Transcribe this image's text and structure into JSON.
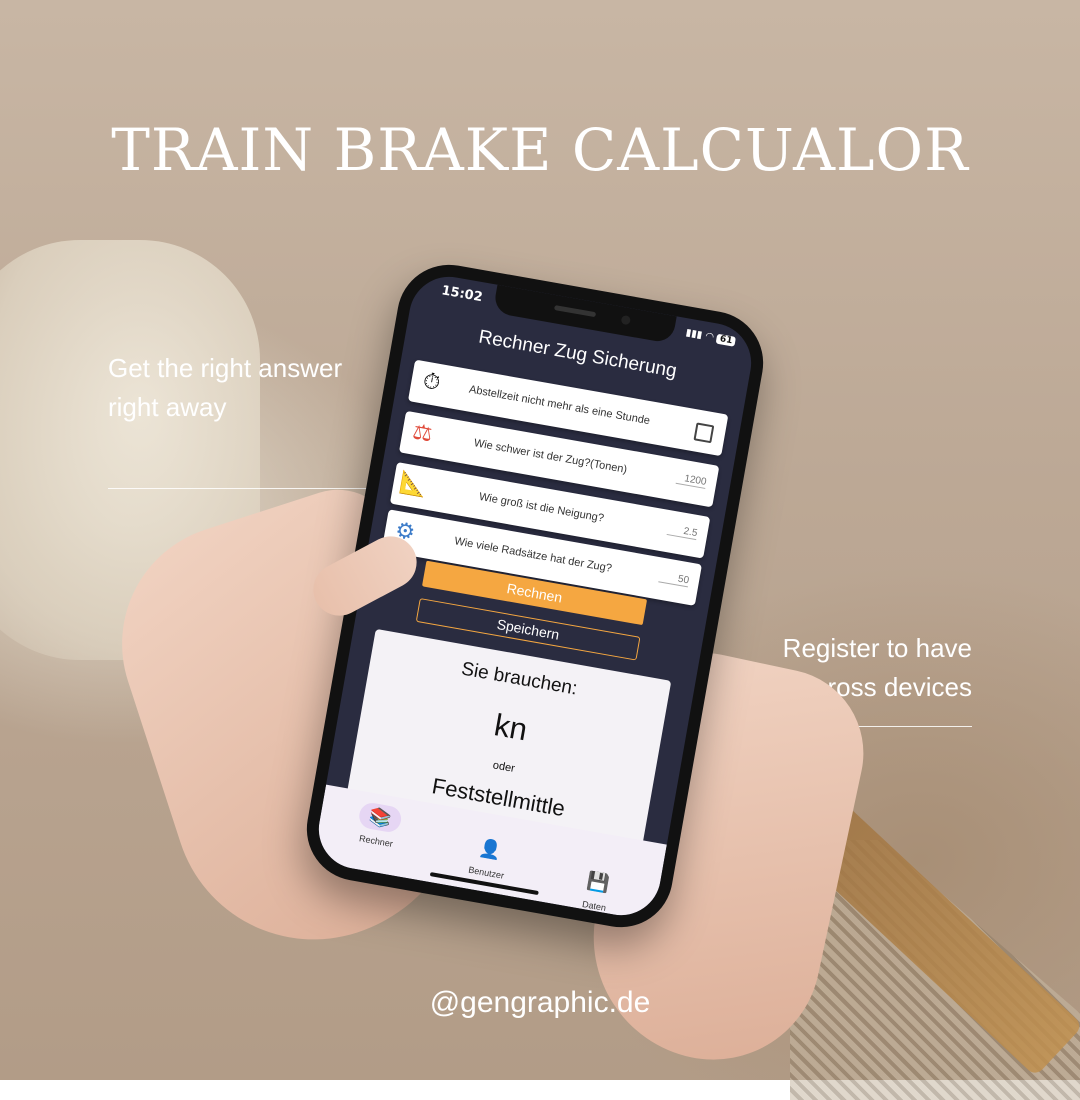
{
  "poster": {
    "title": "TRAIN BRAKE CALCUALOR",
    "tagline_left": [
      "Get the right answer",
      "right away"
    ],
    "tagline_right": [
      "Register to have",
      "acces across devices"
    ],
    "handle": "@gengraphic.de"
  },
  "status": {
    "time": "15:02",
    "battery": "61"
  },
  "app": {
    "title": "Rechner Zug Sicherung",
    "rows": [
      {
        "icon": "stopwatch-icon",
        "label": "Abstellzeit nicht mehr als eine Stunde",
        "control": "checkbox",
        "checked": false
      },
      {
        "icon": "scale-icon",
        "label": "Wie schwer ist der Zug?(Tonen)",
        "control": "input",
        "placeholder": "1200"
      },
      {
        "icon": "ruler-triangle-icon",
        "label": "Wie groß ist die Neigung?",
        "control": "input",
        "placeholder": "2.5"
      },
      {
        "icon": "wheelset-icon",
        "label": "Wie viele Radsätze hat der Zug?",
        "control": "input",
        "placeholder": "50"
      }
    ],
    "buttons": {
      "calculate": "Rechnen",
      "save": "Speichern"
    },
    "result": {
      "heading": "Sie brauchen:",
      "value": "kn",
      "or": "oder",
      "alternative": "Feststellmittle"
    },
    "tabs": [
      {
        "label": "Rechner",
        "icon": "books-icon",
        "active": true
      },
      {
        "label": "Benutzer",
        "icon": "user-icon",
        "active": false
      },
      {
        "label": "Daten",
        "icon": "floppy-disk-icon",
        "active": false
      }
    ],
    "colors": {
      "accent": "#f5a741",
      "background": "#2a2c40",
      "tab_active": "#e6d6f4"
    }
  }
}
